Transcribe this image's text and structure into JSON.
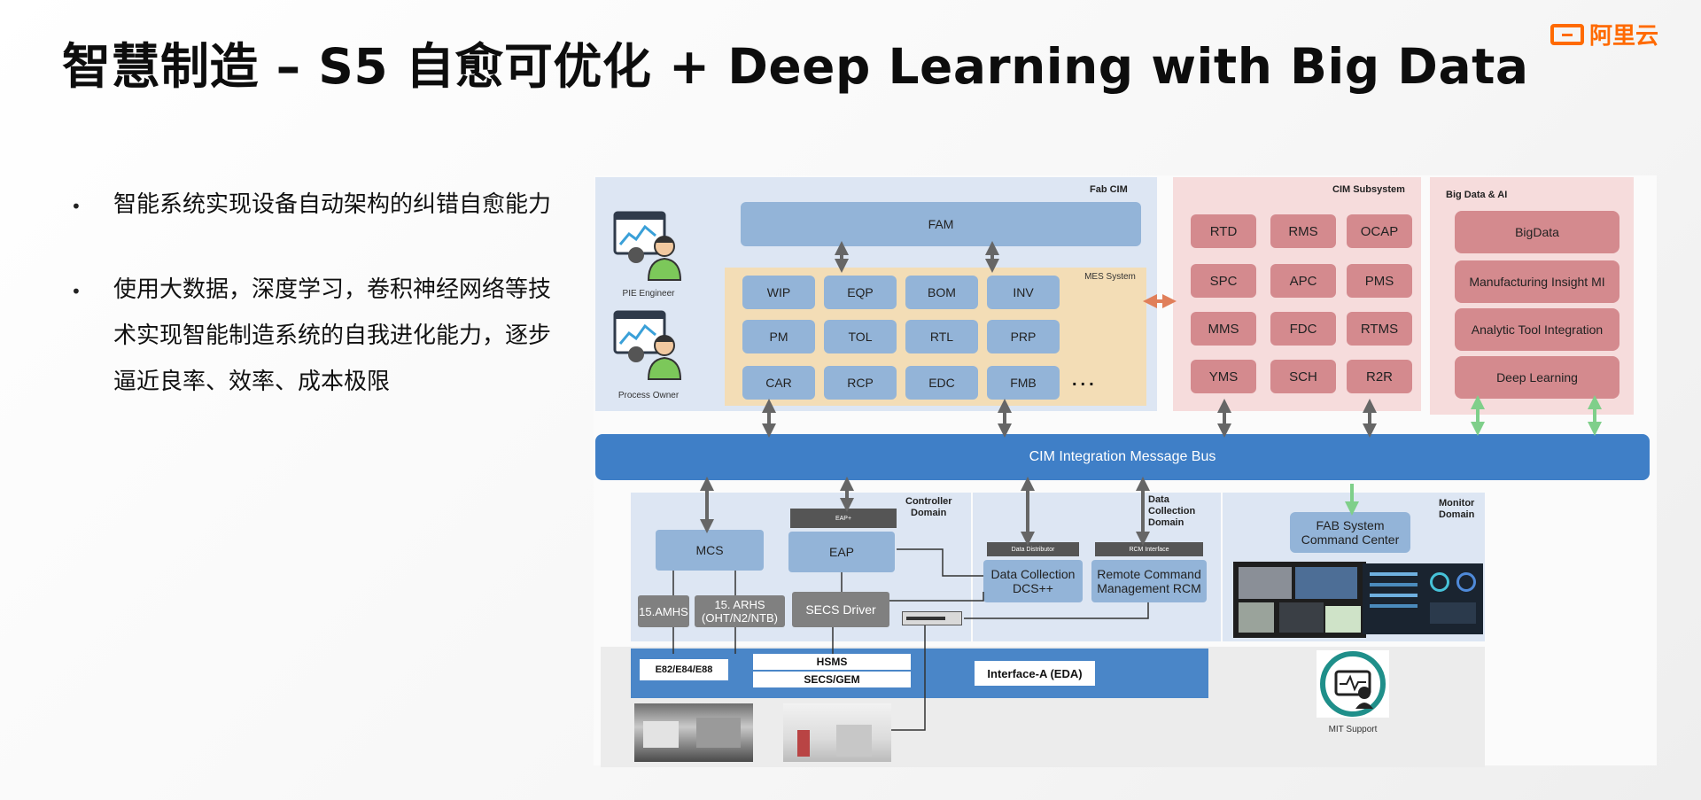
{
  "title": "智慧制造 – S5 自愈可优化 + Deep Learning with Big Data",
  "logo": {
    "text": "阿里云"
  },
  "bullets": [
    {
      "text": "智能系统实现设备自动架构的纠错自愈能力"
    },
    {
      "text": "使用大数据，深度学习，卷积神经网络等技术实现智能制造系统的自我进化能力，逐步逼近良率、效率、成本极限"
    }
  ],
  "diagram": {
    "fab_cim": {
      "title": "Fab CIM",
      "fam": "FAM",
      "people": [
        "PIE Engineer",
        "Process Owner"
      ],
      "mes_title": "MES System",
      "mes_modules": [
        "WIP",
        "EQP",
        "BOM",
        "INV",
        "PM",
        "TOL",
        "RTL",
        "PRP",
        "CAR",
        "RCP",
        "EDC",
        "FMB"
      ],
      "ellipsis": "..."
    },
    "cim_subsystem": {
      "title": "CIM Subsystem",
      "modules": [
        "RTD",
        "RMS",
        "OCAP",
        "SPC",
        "APC",
        "PMS",
        "MMS",
        "FDC",
        "RTMS",
        "YMS",
        "SCH",
        "R2R"
      ]
    },
    "bigdata_ai": {
      "title": "Big Data & AI",
      "modules": [
        "BigData",
        "Manufacturing Insight MI",
        "Analytic Tool Integration",
        "Deep Learning"
      ]
    },
    "bus": "CIM Integration Message Bus",
    "controller_domain": {
      "title_line1": "Controller",
      "title_line2": "Domain",
      "mcs": "MCS",
      "eap_label": "EAP+",
      "eap": "EAP",
      "amhs": "15.AMHS",
      "arhs": "15. ARHS (OHT/N2/NTB)",
      "secs_driver": "SECS Driver"
    },
    "data_collection_domain": {
      "title_line1": "Data",
      "title_line2": "Collection",
      "title_line3": "Domain",
      "dd_label": "Data Distributor",
      "dcs": "Data Collection DCS++",
      "rcm_label": "RCM Interface",
      "rcm": "Remote Command Management RCM"
    },
    "monitor_domain": {
      "title_line1": "Monitor",
      "title_line2": "Domain",
      "fab_command": "FAB System Command Center",
      "mit": "MIT Support"
    },
    "interface": {
      "e_standards": "E82/E84/E88",
      "hsms": "HSMS",
      "secs_gem": "SECS/GEM",
      "interface_a": "Interface-A (EDA)"
    }
  }
}
